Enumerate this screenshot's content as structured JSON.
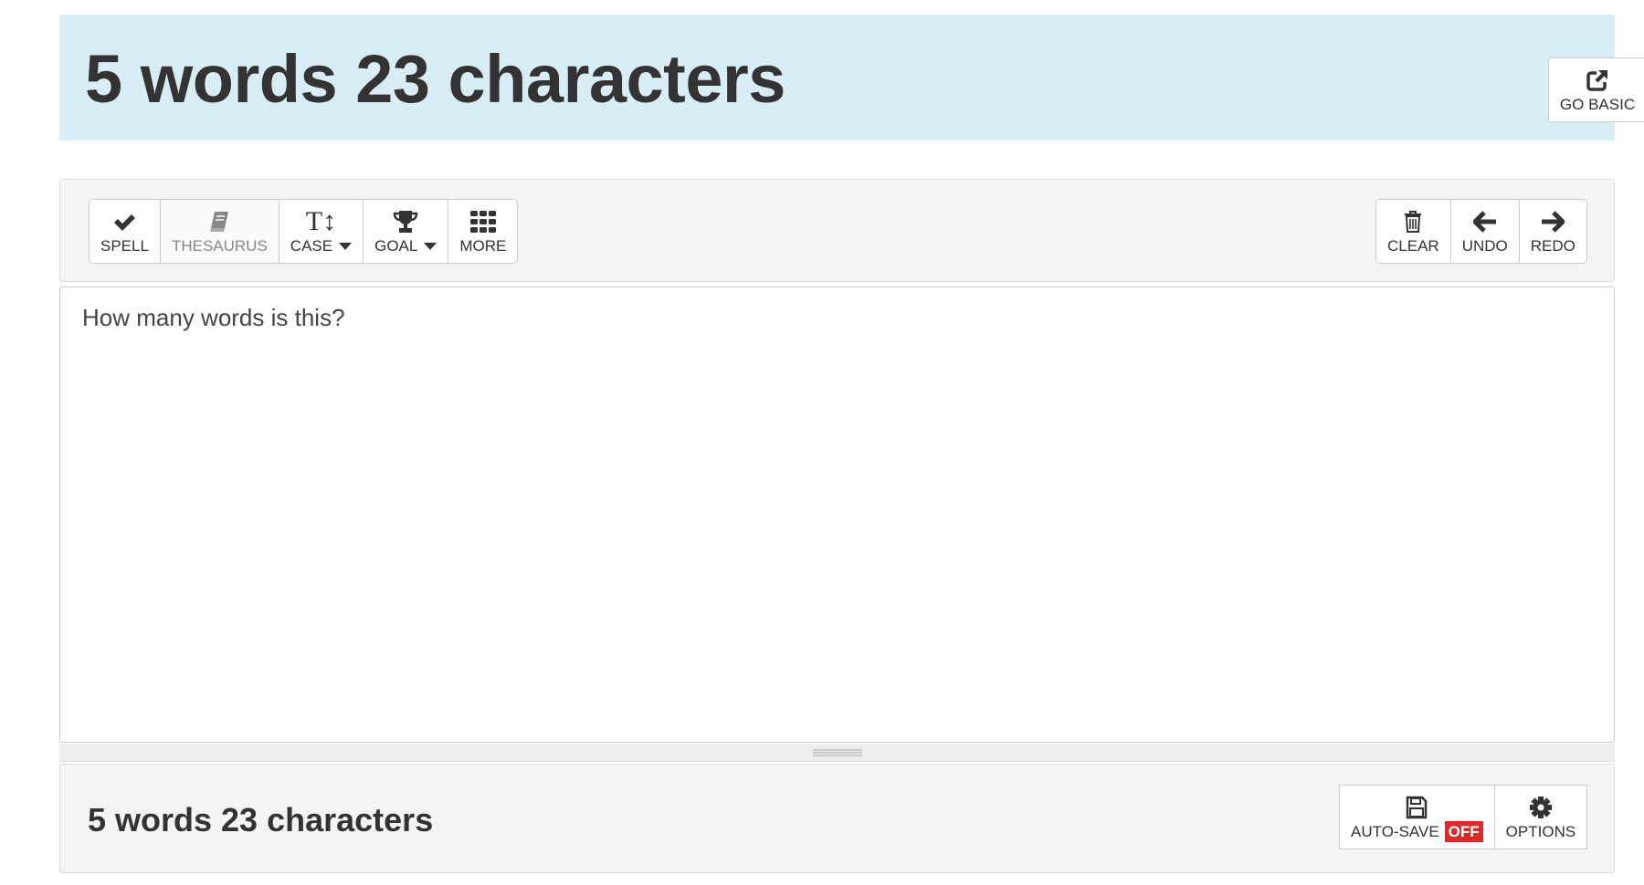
{
  "header": {
    "title": "5 words 23 characters",
    "go_basic_label": "GO BASIC",
    "go_basic_icon": "external-link-icon"
  },
  "toolbar": {
    "left": [
      {
        "label": "SPELL",
        "icon": "check-icon"
      },
      {
        "label": "THESAURUS",
        "icon": "book-icon",
        "disabled": true
      },
      {
        "label": "CASE",
        "icon": "text-height-icon",
        "dropdown": true
      },
      {
        "label": "GOAL",
        "icon": "trophy-icon",
        "dropdown": true
      },
      {
        "label": "MORE",
        "icon": "grid-icon"
      }
    ],
    "right": [
      {
        "label": "CLEAR",
        "icon": "trash-icon"
      },
      {
        "label": "UNDO",
        "icon": "arrow-left-icon"
      },
      {
        "label": "REDO",
        "icon": "arrow-right-icon"
      }
    ]
  },
  "editor": {
    "value": "How many words is this?"
  },
  "footer": {
    "count": "5 words 23 characters",
    "autosave_label": "AUTO-SAVE",
    "autosave_state": "OFF",
    "options_label": "OPTIONS"
  },
  "colors": {
    "header_bg": "#d9edf7",
    "off_badge": "#d62c2c"
  }
}
